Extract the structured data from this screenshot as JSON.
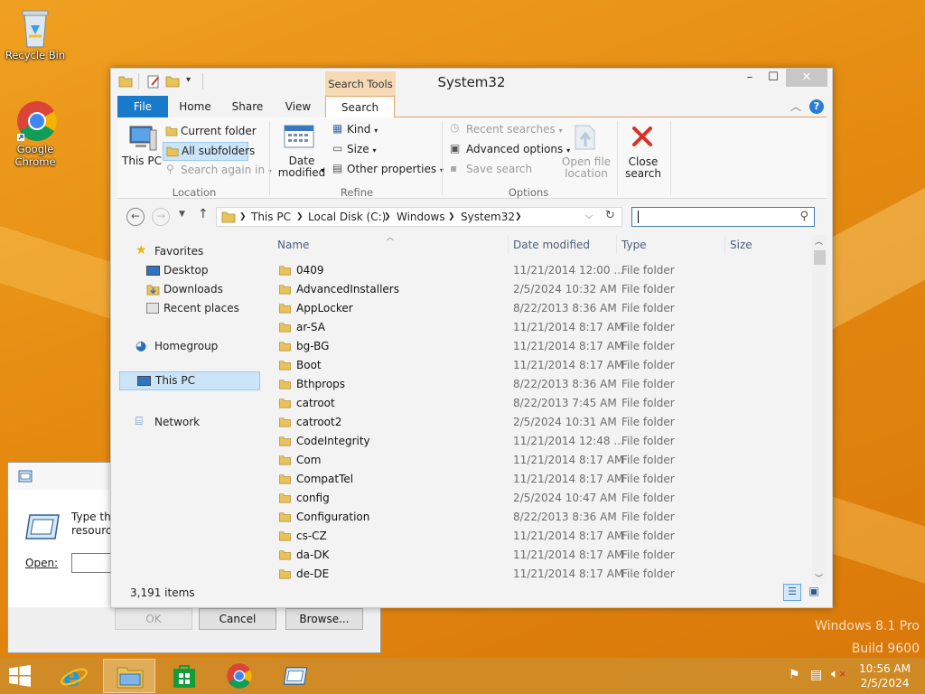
{
  "desktop": {
    "icons": [
      {
        "label": "Recycle Bin"
      },
      {
        "label": "Google Chrome"
      }
    ],
    "watermark": [
      "Windows 8.1 Pro",
      "Build 9600"
    ]
  },
  "run_dialog": {
    "prompt": "Type the",
    "prompt2": "resource",
    "open_label": "Open:",
    "ok": "OK",
    "cancel": "Cancel",
    "browse": "Browse..."
  },
  "explorer": {
    "title": "System32",
    "context_tab": "Search Tools",
    "window_buttons": {
      "minimize": "–",
      "maximize": "☐",
      "close": "✕"
    },
    "tabs": [
      {
        "label": "File"
      },
      {
        "label": "Home"
      },
      {
        "label": "Share"
      },
      {
        "label": "View"
      },
      {
        "label": "Search"
      }
    ],
    "ribbon": {
      "this_pc": "This PC",
      "current_folder": "Current folder",
      "all_subfolders": "All subfolders",
      "search_again": "Search again in",
      "location_group": "Location",
      "date_modified": "Date modified",
      "kind": "Kind",
      "size": "Size",
      "other_properties": "Other properties",
      "refine_group": "Refine",
      "recent_searches": "Recent searches",
      "advanced_options": "Advanced options",
      "save_search": "Save search",
      "open_file_location": "Open file location",
      "options_group": "Options",
      "close_search": "Close search"
    },
    "address": {
      "crumbs": [
        "This PC",
        "Local Disk (C:)",
        "Windows",
        "System32"
      ],
      "search_value": ""
    },
    "nav": {
      "favorites": "Favorites",
      "desktop": "Desktop",
      "downloads": "Downloads",
      "recent": "Recent places",
      "homegroup": "Homegroup",
      "this_pc": "This PC",
      "network": "Network"
    },
    "columns": {
      "name": "Name",
      "date": "Date modified",
      "type": "Type",
      "size": "Size"
    },
    "rows": [
      {
        "name": "0409",
        "date": "11/21/2014 12:00 ...",
        "type": "File folder"
      },
      {
        "name": "AdvancedInstallers",
        "date": "2/5/2024 10:32 AM",
        "type": "File folder"
      },
      {
        "name": "AppLocker",
        "date": "8/22/2013 8:36 AM",
        "type": "File folder"
      },
      {
        "name": "ar-SA",
        "date": "11/21/2014 8:17 AM",
        "type": "File folder"
      },
      {
        "name": "bg-BG",
        "date": "11/21/2014 8:17 AM",
        "type": "File folder"
      },
      {
        "name": "Boot",
        "date": "11/21/2014 8:17 AM",
        "type": "File folder"
      },
      {
        "name": "Bthprops",
        "date": "8/22/2013 8:36 AM",
        "type": "File folder"
      },
      {
        "name": "catroot",
        "date": "8/22/2013 7:45 AM",
        "type": "File folder"
      },
      {
        "name": "catroot2",
        "date": "2/5/2024 10:31 AM",
        "type": "File folder"
      },
      {
        "name": "CodeIntegrity",
        "date": "11/21/2014 12:48 ...",
        "type": "File folder"
      },
      {
        "name": "Com",
        "date": "11/21/2014 8:17 AM",
        "type": "File folder"
      },
      {
        "name": "CompatTel",
        "date": "11/21/2014 8:17 AM",
        "type": "File folder"
      },
      {
        "name": "config",
        "date": "2/5/2024 10:47 AM",
        "type": "File folder"
      },
      {
        "name": "Configuration",
        "date": "8/22/2013 8:36 AM",
        "type": "File folder"
      },
      {
        "name": "cs-CZ",
        "date": "11/21/2014 8:17 AM",
        "type": "File folder"
      },
      {
        "name": "da-DK",
        "date": "11/21/2014 8:17 AM",
        "type": "File folder"
      },
      {
        "name": "de-DE",
        "date": "11/21/2014 8:17 AM",
        "type": "File folder"
      }
    ],
    "status": "3,191 items"
  },
  "taskbar": {
    "time": "10:56 AM",
    "date": "2/5/2024"
  },
  "colors": {
    "file_tab": "#1979ca",
    "context_tab": "#f6d9b5",
    "folder": "#e8c25a"
  }
}
